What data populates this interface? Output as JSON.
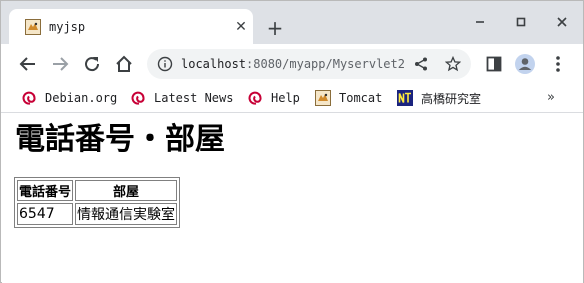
{
  "browser": {
    "tab": {
      "title": "myjsp",
      "favicon": "tomcat-icon"
    },
    "new_tab_label": "+",
    "window_controls": [
      "minimize",
      "maximize",
      "close"
    ],
    "address": {
      "host": "localhost",
      "rest": ":8080/myapp/Myservlet2"
    },
    "bookmarks": [
      {
        "label": "Debian.org",
        "icon": "debian-icon"
      },
      {
        "label": "Latest News",
        "icon": "debian-icon"
      },
      {
        "label": "Help",
        "icon": "debian-icon"
      },
      {
        "label": "Tomcat",
        "icon": "tomcat-icon"
      },
      {
        "label": "高橋研究室",
        "icon": "nt-icon"
      }
    ],
    "overflow_label": "»"
  },
  "page": {
    "title": "電話番号・部屋",
    "table": {
      "headers": [
        "電話番号",
        "部屋"
      ],
      "rows": [
        [
          "6547",
          "情報通信実験室"
        ]
      ]
    }
  },
  "colors": {
    "tabstrip": "#dee1e6",
    "omnibox": "#f1f3f4",
    "debian": "#c70036",
    "icon": "#5f6368",
    "nt_bg": "#1a237e",
    "nt_fg": "#ffeb3b"
  }
}
